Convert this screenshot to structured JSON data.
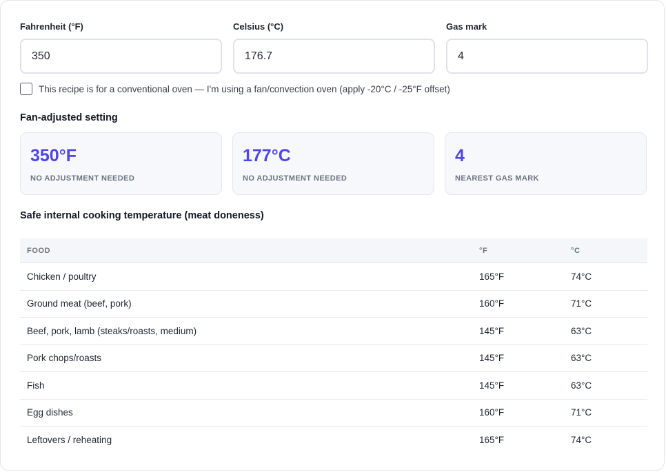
{
  "inputs": {
    "fahrenheit": {
      "label": "Fahrenheit (°F)",
      "value": "350"
    },
    "celsius": {
      "label": "Celsius (°C)",
      "value": "176.7"
    },
    "gas_mark": {
      "label": "Gas mark",
      "value": "4"
    }
  },
  "fan_option": {
    "checked": false,
    "label": "This recipe is for a conventional oven — I'm using a fan/convection oven (apply -20°C / -25°F offset)"
  },
  "fan_adjusted": {
    "title": "Fan-adjusted setting",
    "results": [
      {
        "value": "350°F",
        "note": "NO ADJUSTMENT NEEDED"
      },
      {
        "value": "177°C",
        "note": "NO ADJUSTMENT NEEDED"
      },
      {
        "value": "4",
        "note": "NEAREST GAS MARK"
      }
    ]
  },
  "doneness": {
    "title": "Safe internal cooking temperature (meat doneness)",
    "headers": [
      "FOOD",
      "°F",
      "°C"
    ],
    "rows": [
      [
        "Chicken / poultry",
        "165°F",
        "74°C"
      ],
      [
        "Ground meat (beef, pork)",
        "160°F",
        "71°C"
      ],
      [
        "Beef, pork, lamb (steaks/roasts, medium)",
        "145°F",
        "63°C"
      ],
      [
        "Pork chops/roasts",
        "145°F",
        "63°C"
      ],
      [
        "Fish",
        "145°F",
        "63°C"
      ],
      [
        "Egg dishes",
        "160°F",
        "71°C"
      ],
      [
        "Leftovers / reheating",
        "165°F",
        "74°C"
      ]
    ]
  },
  "colors": {
    "accent": "#4f46e5",
    "muted": "#6b7280",
    "border": "#dfe2e8"
  }
}
